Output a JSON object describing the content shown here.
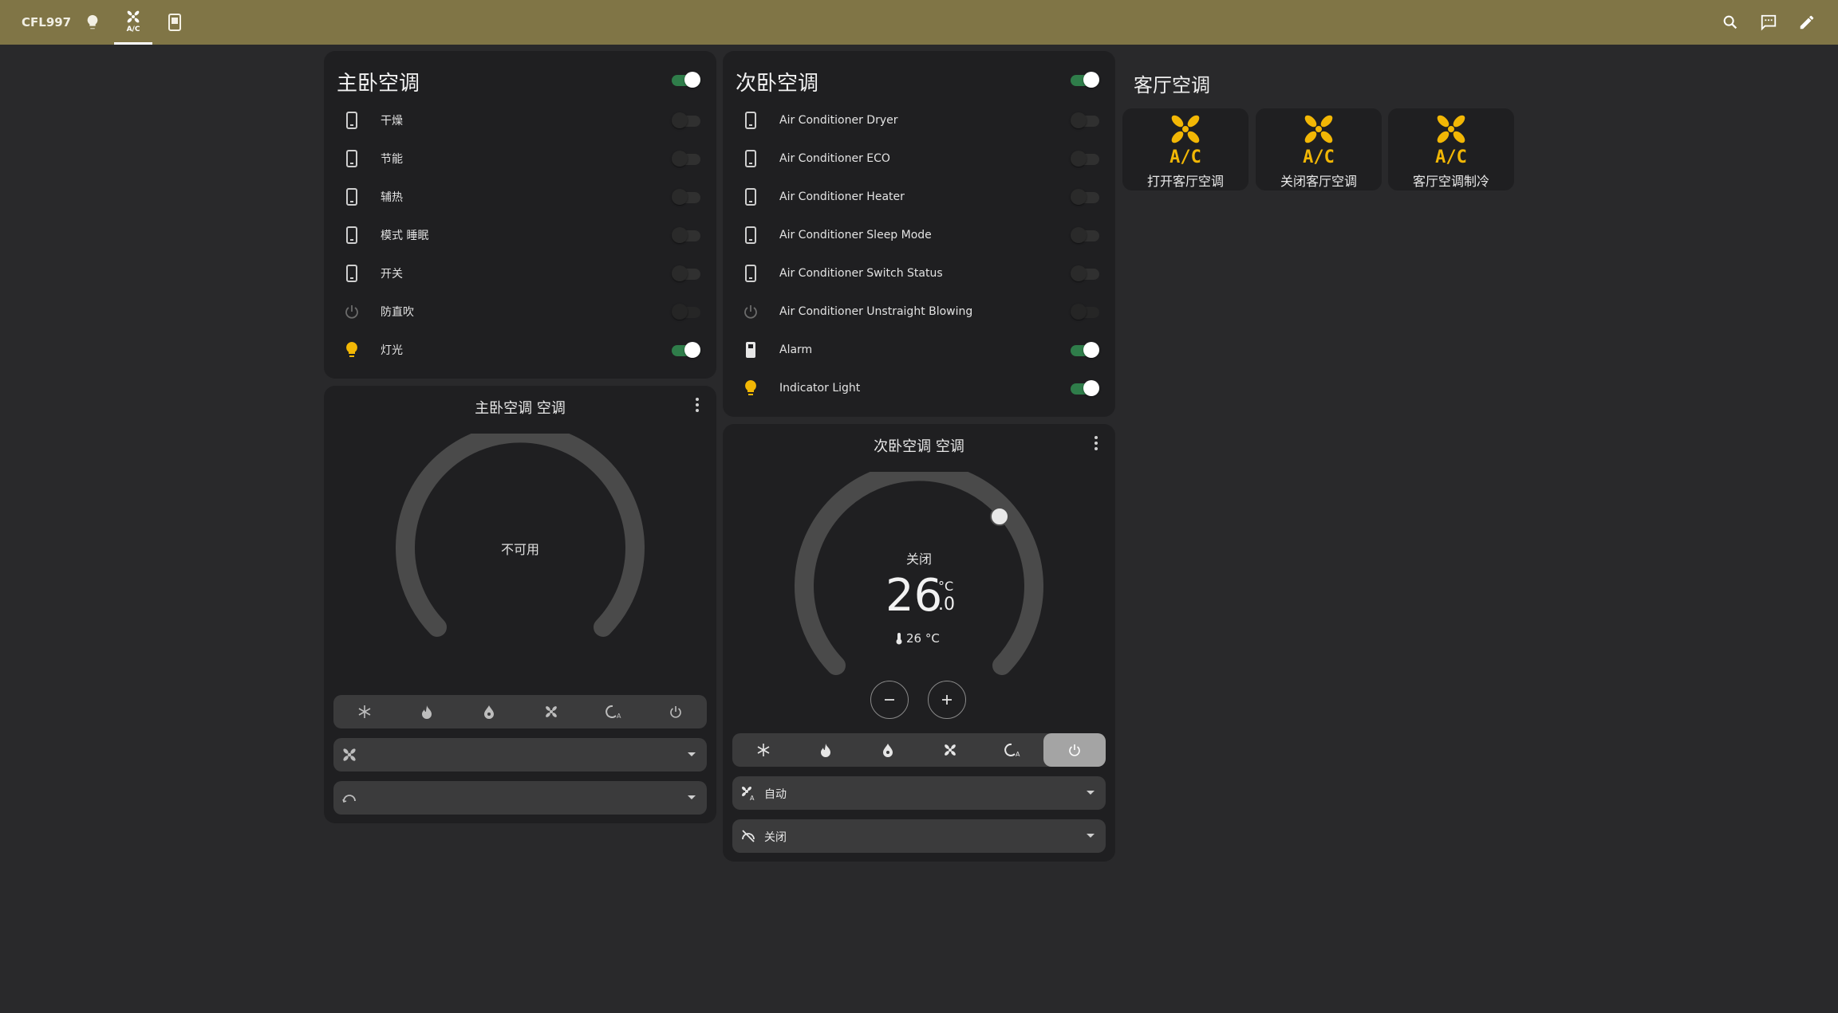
{
  "header": {
    "brand": "CFL997",
    "tabs": [
      {
        "icon": "lightbulb-icon",
        "active": false
      },
      {
        "icon": "ac-fan-icon",
        "active": true,
        "icon_text": "A/C"
      },
      {
        "icon": "phone-panel-icon",
        "active": false
      }
    ],
    "actions": [
      "search-icon",
      "assist-chat-icon",
      "edit-pencil-icon"
    ]
  },
  "colors": {
    "header_bg": "#807546",
    "page_bg": "#29292b",
    "card_bg": "#1f1f21",
    "toggle_on": "#2f7d4a",
    "accent_yellow": "#f2b705"
  },
  "master_bedroom": {
    "title": "主卧空调",
    "master_on": true,
    "rows": [
      {
        "icon": "phone-icon",
        "label": "干燥",
        "state": "off"
      },
      {
        "icon": "phone-icon",
        "label": "节能",
        "state": "off"
      },
      {
        "icon": "phone-icon",
        "label": "辅热",
        "state": "off"
      },
      {
        "icon": "phone-icon",
        "label": "模式 睡眠",
        "state": "off"
      },
      {
        "icon": "phone-icon",
        "label": "开关",
        "state": "off"
      },
      {
        "icon": "power-icon",
        "label": "防直吹",
        "state": "disabled"
      },
      {
        "icon": "bulb-icon",
        "label": "灯光",
        "state": "on"
      }
    ],
    "thermostat": {
      "title": "主卧空调 空调",
      "status": "不可用",
      "fan_mode": "",
      "swing_mode": ""
    }
  },
  "second_bedroom": {
    "title": "次卧空调",
    "master_on": true,
    "rows": [
      {
        "icon": "phone-icon",
        "label": "Air Conditioner Dryer",
        "state": "off"
      },
      {
        "icon": "phone-icon",
        "label": "Air Conditioner ECO",
        "state": "off"
      },
      {
        "icon": "phone-icon",
        "label": "Air Conditioner Heater",
        "state": "off"
      },
      {
        "icon": "phone-icon",
        "label": "Air Conditioner Sleep Mode",
        "state": "off"
      },
      {
        "icon": "phone-icon",
        "label": "Air Conditioner Switch Status",
        "state": "off"
      },
      {
        "icon": "power-icon",
        "label": "Air Conditioner Unstraight Blowing",
        "state": "disabled"
      },
      {
        "icon": "remote-icon",
        "label": "Alarm",
        "state": "on"
      },
      {
        "icon": "bulb-icon",
        "label": "Indicator Light",
        "state": "on"
      }
    ],
    "thermostat": {
      "title": "次卧空调 空调",
      "status": "关闭",
      "target_int": "26",
      "target_dec": ".0",
      "unit": "°C",
      "current": "26 °C",
      "active_mode": "off",
      "fan_mode": "自动",
      "swing_mode": "关闭"
    }
  },
  "living_room": {
    "title": "客厅空调",
    "tiles": [
      {
        "label": "打开客厅空调",
        "icon": "ac-fan-icon",
        "icon_text": "A/C"
      },
      {
        "label": "关闭客厅空调",
        "icon": "ac-fan-icon",
        "icon_text": "A/C"
      },
      {
        "label": "客厅空调制冷",
        "icon": "ac-fan-icon",
        "icon_text": "A/C"
      }
    ]
  }
}
